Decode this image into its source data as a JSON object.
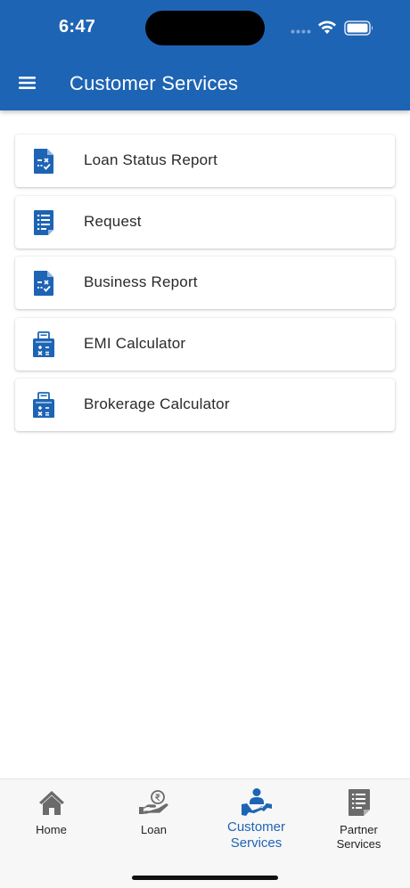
{
  "status_bar": {
    "time": "6:47"
  },
  "header": {
    "title": "Customer Services",
    "menu_icon": "hamburger-menu-icon",
    "background_color": "#1e64b4"
  },
  "list": {
    "items": [
      {
        "label": "Loan Status Report",
        "icon": "report-document-icon"
      },
      {
        "label": "Request",
        "icon": "list-document-icon"
      },
      {
        "label": "Business Report",
        "icon": "report-document-icon"
      },
      {
        "label": "EMI Calculator",
        "icon": "calculator-icon"
      },
      {
        "label": "Brokerage Calculator",
        "icon": "calculator-icon"
      }
    ]
  },
  "bottom_nav": {
    "items": [
      {
        "label": "Home",
        "icon": "home-icon",
        "active": false
      },
      {
        "label": "Loan",
        "icon": "rupee-hand-icon",
        "active": false
      },
      {
        "label": "Customer\nServices",
        "icon": "customer-support-icon",
        "active": true
      },
      {
        "label": "Partner\nServices",
        "icon": "document-list-icon",
        "active": false
      }
    ],
    "active_color": "#1e64b4",
    "inactive_color": "#6b6b6b"
  }
}
